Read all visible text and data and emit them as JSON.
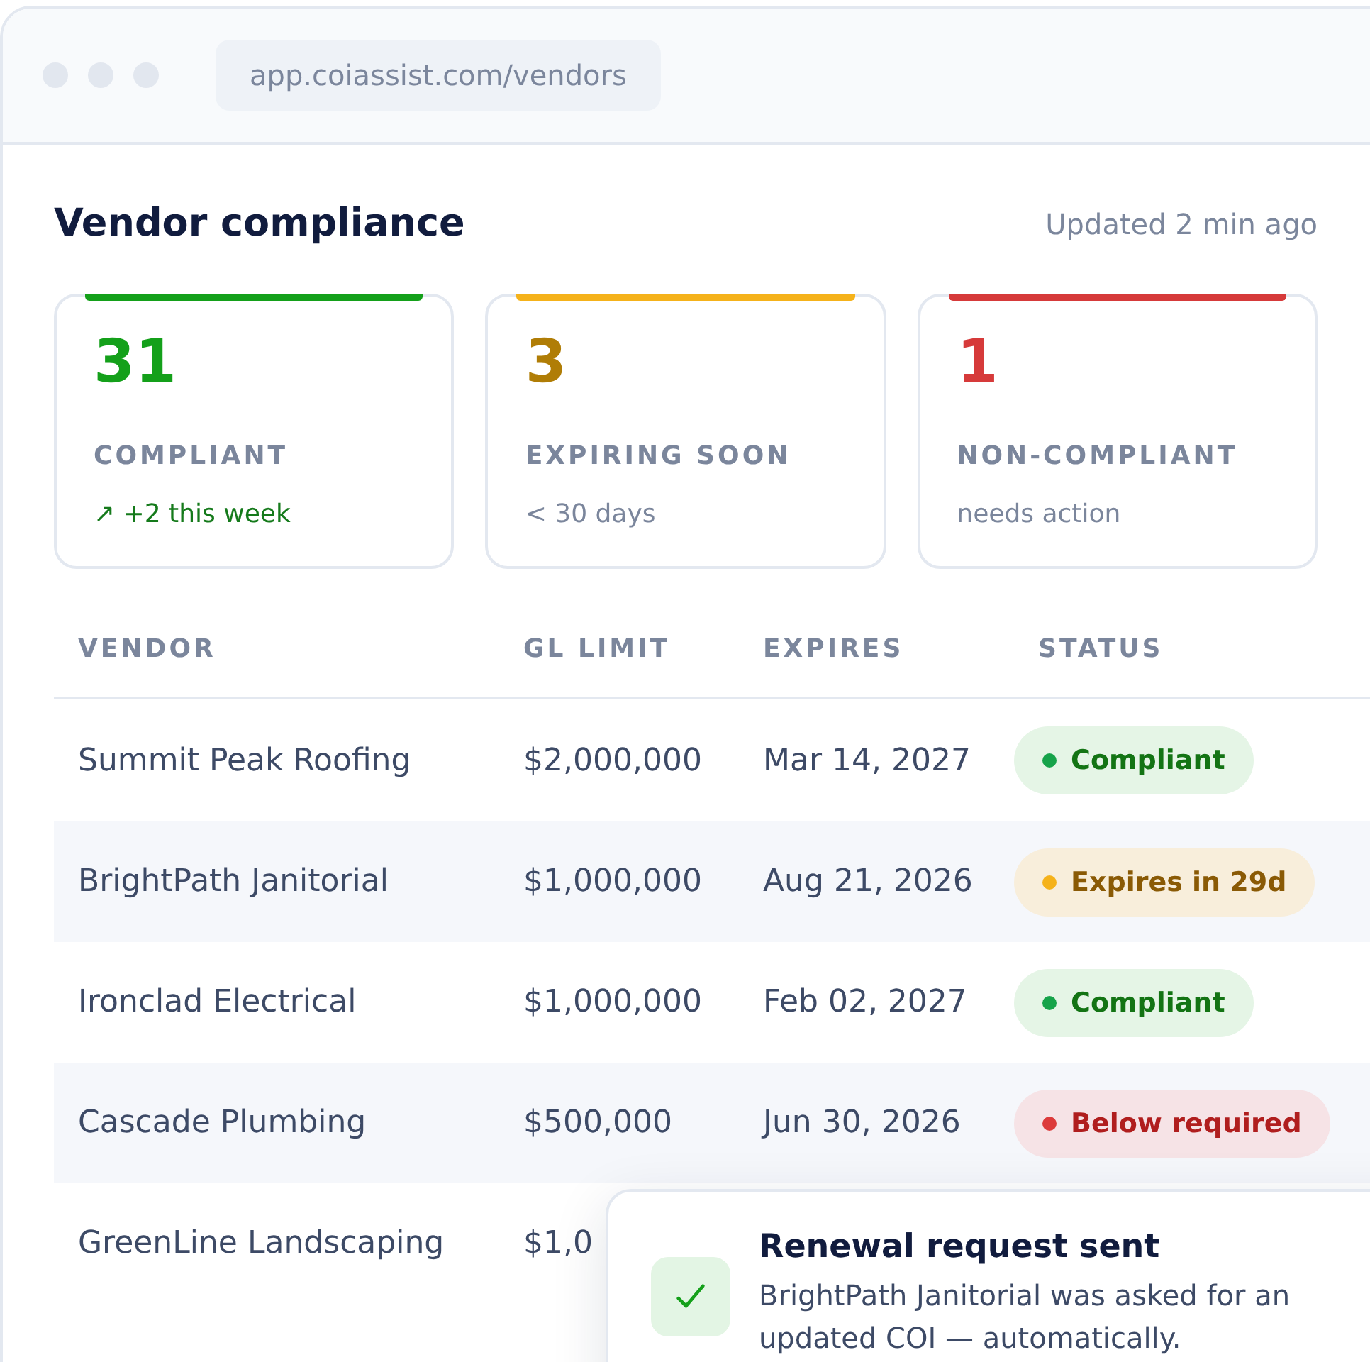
{
  "browser": {
    "url": "app.coiassist.com/vendors"
  },
  "header": {
    "title": "Vendor compliance",
    "updated": "Updated 2 min ago"
  },
  "stats": [
    {
      "kind": "good",
      "value": "31",
      "label": "COMPLIANT",
      "note": "↗ +2 this week"
    },
    {
      "kind": "warn",
      "value": "3",
      "label": "EXPIRING SOON",
      "note": "< 30 days"
    },
    {
      "kind": "bad",
      "value": "1",
      "label": "NON-COMPLIANT",
      "note": "needs action"
    }
  ],
  "table": {
    "columns": [
      "VENDOR",
      "GL LIMIT",
      "EXPIRES",
      "STATUS"
    ],
    "rows": [
      {
        "vendor": "Summit Peak Roofing",
        "gl_limit": "$2,000,000",
        "expires": "Mar 14, 2027",
        "status": {
          "kind": "good",
          "label": "Compliant",
          "color": "#16a34a"
        }
      },
      {
        "vendor": "BrightPath Janitorial",
        "gl_limit": "$1,000,000",
        "expires": "Aug 21, 2026",
        "status": {
          "kind": "warn",
          "label": "Expires in 29d",
          "color": "#f5b21a"
        }
      },
      {
        "vendor": "Ironclad Electrical",
        "gl_limit": "$1,000,000",
        "expires": "Feb 02, 2027",
        "status": {
          "kind": "good",
          "label": "Compliant",
          "color": "#16a34a"
        }
      },
      {
        "vendor": "Cascade Plumbing",
        "gl_limit": "$500,000",
        "expires": "Jun 30, 2026",
        "status": {
          "kind": "bad",
          "label": "Below required",
          "color": "#dc3b3b"
        }
      },
      {
        "vendor": "GreenLine Landscaping",
        "gl_limit": "$1,0"
      }
    ]
  },
  "toast": {
    "title": "Renewal request sent",
    "message": "BrightPath Janitorial was asked for an updated COI — automatically."
  }
}
